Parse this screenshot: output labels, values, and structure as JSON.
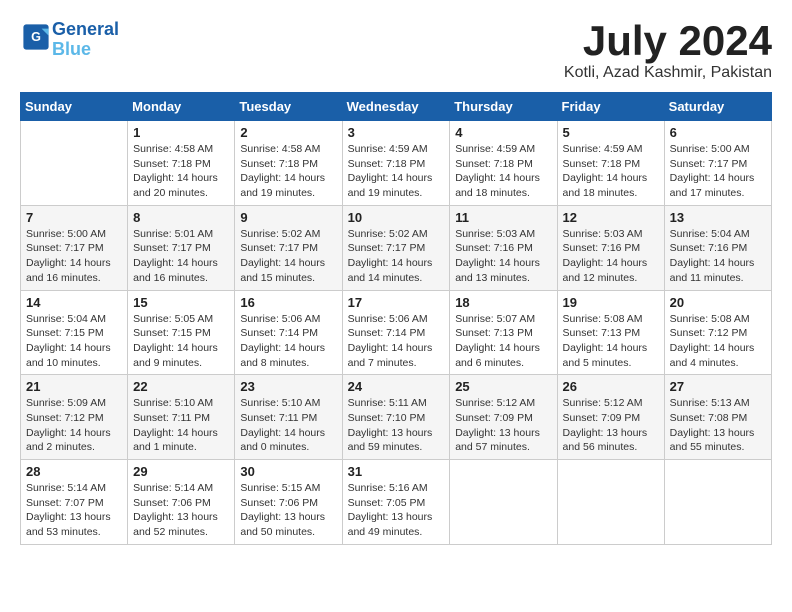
{
  "header": {
    "logo_line1": "General",
    "logo_line2": "Blue",
    "month": "July 2024",
    "location": "Kotli, Azad Kashmir, Pakistan"
  },
  "days_of_week": [
    "Sunday",
    "Monday",
    "Tuesday",
    "Wednesday",
    "Thursday",
    "Friday",
    "Saturday"
  ],
  "weeks": [
    [
      {
        "day": "",
        "info": ""
      },
      {
        "day": "1",
        "info": "Sunrise: 4:58 AM\nSunset: 7:18 PM\nDaylight: 14 hours\nand 20 minutes."
      },
      {
        "day": "2",
        "info": "Sunrise: 4:58 AM\nSunset: 7:18 PM\nDaylight: 14 hours\nand 19 minutes."
      },
      {
        "day": "3",
        "info": "Sunrise: 4:59 AM\nSunset: 7:18 PM\nDaylight: 14 hours\nand 19 minutes."
      },
      {
        "day": "4",
        "info": "Sunrise: 4:59 AM\nSunset: 7:18 PM\nDaylight: 14 hours\nand 18 minutes."
      },
      {
        "day": "5",
        "info": "Sunrise: 4:59 AM\nSunset: 7:18 PM\nDaylight: 14 hours\nand 18 minutes."
      },
      {
        "day": "6",
        "info": "Sunrise: 5:00 AM\nSunset: 7:17 PM\nDaylight: 14 hours\nand 17 minutes."
      }
    ],
    [
      {
        "day": "7",
        "info": "Sunrise: 5:00 AM\nSunset: 7:17 PM\nDaylight: 14 hours\nand 16 minutes."
      },
      {
        "day": "8",
        "info": "Sunrise: 5:01 AM\nSunset: 7:17 PM\nDaylight: 14 hours\nand 16 minutes."
      },
      {
        "day": "9",
        "info": "Sunrise: 5:02 AM\nSunset: 7:17 PM\nDaylight: 14 hours\nand 15 minutes."
      },
      {
        "day": "10",
        "info": "Sunrise: 5:02 AM\nSunset: 7:17 PM\nDaylight: 14 hours\nand 14 minutes."
      },
      {
        "day": "11",
        "info": "Sunrise: 5:03 AM\nSunset: 7:16 PM\nDaylight: 14 hours\nand 13 minutes."
      },
      {
        "day": "12",
        "info": "Sunrise: 5:03 AM\nSunset: 7:16 PM\nDaylight: 14 hours\nand 12 minutes."
      },
      {
        "day": "13",
        "info": "Sunrise: 5:04 AM\nSunset: 7:16 PM\nDaylight: 14 hours\nand 11 minutes."
      }
    ],
    [
      {
        "day": "14",
        "info": "Sunrise: 5:04 AM\nSunset: 7:15 PM\nDaylight: 14 hours\nand 10 minutes."
      },
      {
        "day": "15",
        "info": "Sunrise: 5:05 AM\nSunset: 7:15 PM\nDaylight: 14 hours\nand 9 minutes."
      },
      {
        "day": "16",
        "info": "Sunrise: 5:06 AM\nSunset: 7:14 PM\nDaylight: 14 hours\nand 8 minutes."
      },
      {
        "day": "17",
        "info": "Sunrise: 5:06 AM\nSunset: 7:14 PM\nDaylight: 14 hours\nand 7 minutes."
      },
      {
        "day": "18",
        "info": "Sunrise: 5:07 AM\nSunset: 7:13 PM\nDaylight: 14 hours\nand 6 minutes."
      },
      {
        "day": "19",
        "info": "Sunrise: 5:08 AM\nSunset: 7:13 PM\nDaylight: 14 hours\nand 5 minutes."
      },
      {
        "day": "20",
        "info": "Sunrise: 5:08 AM\nSunset: 7:12 PM\nDaylight: 14 hours\nand 4 minutes."
      }
    ],
    [
      {
        "day": "21",
        "info": "Sunrise: 5:09 AM\nSunset: 7:12 PM\nDaylight: 14 hours\nand 2 minutes."
      },
      {
        "day": "22",
        "info": "Sunrise: 5:10 AM\nSunset: 7:11 PM\nDaylight: 14 hours\nand 1 minute."
      },
      {
        "day": "23",
        "info": "Sunrise: 5:10 AM\nSunset: 7:11 PM\nDaylight: 14 hours\nand 0 minutes."
      },
      {
        "day": "24",
        "info": "Sunrise: 5:11 AM\nSunset: 7:10 PM\nDaylight: 13 hours\nand 59 minutes."
      },
      {
        "day": "25",
        "info": "Sunrise: 5:12 AM\nSunset: 7:09 PM\nDaylight: 13 hours\nand 57 minutes."
      },
      {
        "day": "26",
        "info": "Sunrise: 5:12 AM\nSunset: 7:09 PM\nDaylight: 13 hours\nand 56 minutes."
      },
      {
        "day": "27",
        "info": "Sunrise: 5:13 AM\nSunset: 7:08 PM\nDaylight: 13 hours\nand 55 minutes."
      }
    ],
    [
      {
        "day": "28",
        "info": "Sunrise: 5:14 AM\nSunset: 7:07 PM\nDaylight: 13 hours\nand 53 minutes."
      },
      {
        "day": "29",
        "info": "Sunrise: 5:14 AM\nSunset: 7:06 PM\nDaylight: 13 hours\nand 52 minutes."
      },
      {
        "day": "30",
        "info": "Sunrise: 5:15 AM\nSunset: 7:06 PM\nDaylight: 13 hours\nand 50 minutes."
      },
      {
        "day": "31",
        "info": "Sunrise: 5:16 AM\nSunset: 7:05 PM\nDaylight: 13 hours\nand 49 minutes."
      },
      {
        "day": "",
        "info": ""
      },
      {
        "day": "",
        "info": ""
      },
      {
        "day": "",
        "info": ""
      }
    ]
  ]
}
